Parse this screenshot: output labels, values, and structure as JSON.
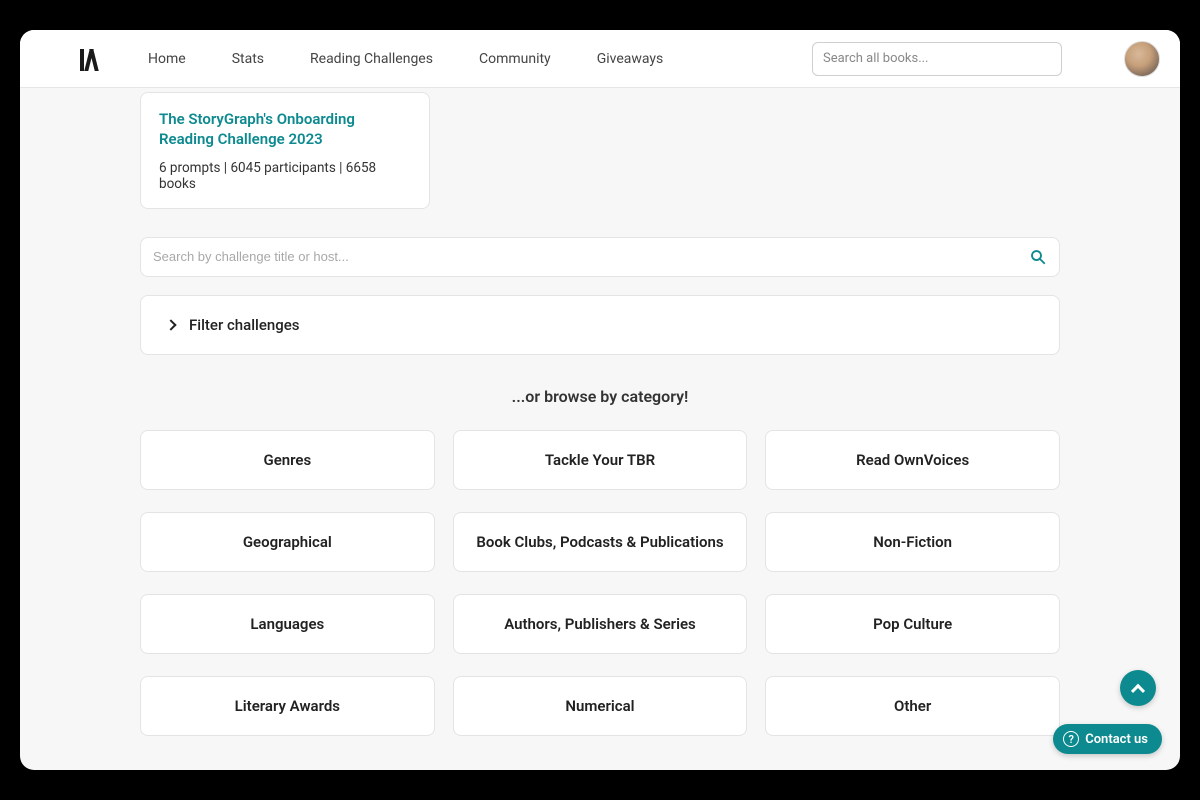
{
  "nav": {
    "items": [
      "Home",
      "Stats",
      "Reading Challenges",
      "Community",
      "Giveaways"
    ],
    "search_placeholder": "Search all books..."
  },
  "challenge_card": {
    "title": "The StoryGraph's Onboarding Reading Challenge 2023",
    "meta": "6 prompts | 6045 participants | 6658 books"
  },
  "challenge_search": {
    "placeholder": "Search by challenge title or host..."
  },
  "filter": {
    "label": "Filter challenges"
  },
  "browse_heading": "...or browse by category!",
  "categories": [
    "Genres",
    "Tackle Your TBR",
    "Read OwnVoices",
    "Geographical",
    "Book Clubs, Podcasts & Publications",
    "Non-Fiction",
    "Languages",
    "Authors, Publishers & Series",
    "Pop Culture",
    "Literary Awards",
    "Numerical",
    "Other"
  ],
  "contact": {
    "label": "Contact us"
  }
}
